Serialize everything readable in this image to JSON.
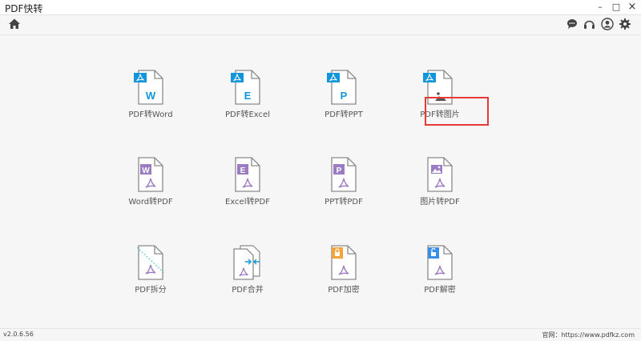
{
  "window": {
    "title": "PDF快转",
    "minimize": "–",
    "maximize": "□",
    "close": "×"
  },
  "colors": {
    "word_blue": "#1296db",
    "purple": "#9b7cc2",
    "orange": "#f2a33a",
    "light_blue": "#3a8ee6",
    "pdf_red": "#b5b5b5",
    "highlight": "#e53935"
  },
  "tools": [
    {
      "label": "PDF转Word",
      "letter": "W",
      "icon": "pdf-to-word-icon"
    },
    {
      "label": "PDF转Excel",
      "letter": "E",
      "icon": "pdf-to-excel-icon"
    },
    {
      "label": "PDF转PPT",
      "letter": "P",
      "icon": "pdf-to-ppt-icon"
    },
    {
      "label": "PDF转图片",
      "letter": "",
      "icon": "pdf-to-image-icon"
    },
    {
      "label": "Word转PDF",
      "letter": "W",
      "icon": "word-to-pdf-icon"
    },
    {
      "label": "Excel转PDF",
      "letter": "E",
      "icon": "excel-to-pdf-icon"
    },
    {
      "label": "PPT转PDF",
      "letter": "P",
      "icon": "ppt-to-pdf-icon"
    },
    {
      "label": "图片转PDF",
      "letter": "",
      "icon": "image-to-pdf-icon"
    },
    {
      "label": "PDF拆分",
      "letter": "",
      "icon": "pdf-split-icon"
    },
    {
      "label": "PDF合并",
      "letter": "",
      "icon": "pdf-merge-icon"
    },
    {
      "label": "PDF加密",
      "letter": "",
      "icon": "pdf-encrypt-icon"
    },
    {
      "label": "PDF解密",
      "letter": "",
      "icon": "pdf-decrypt-icon"
    }
  ],
  "footer": {
    "version": "v2.0.6.56",
    "site": "官网：https://www.pdfkz.com"
  }
}
